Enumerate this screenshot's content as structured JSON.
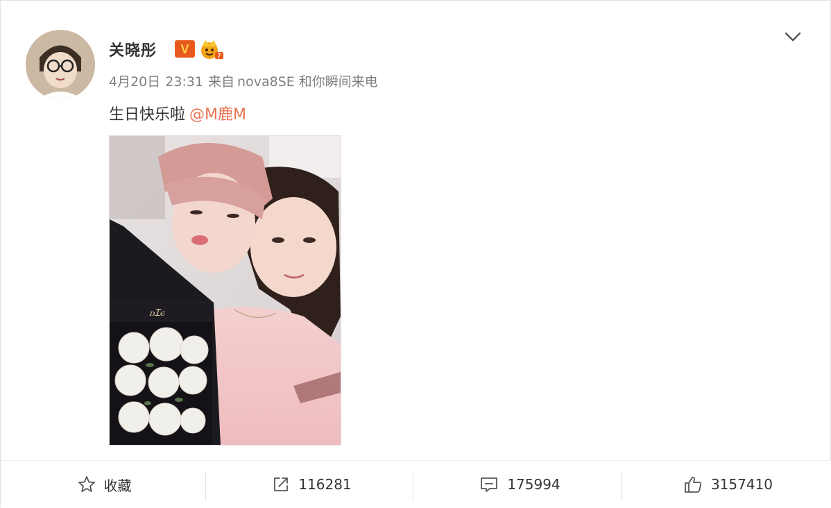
{
  "post": {
    "author": {
      "name": "关晓彤",
      "verified_badge": "V"
    },
    "meta": {
      "date": "4月20日",
      "time": "23:31",
      "source_prefix": "来自",
      "source": "nova8SE 和你瞬间来电"
    },
    "text": "生日快乐啦",
    "mention": "@M鹿M"
  },
  "actions": {
    "favorite_label": "收藏",
    "repost_count": "116281",
    "comment_count": "175994",
    "like_count": "3157410"
  },
  "colors": {
    "accent": "#eb7350",
    "meta_text": "#808080",
    "text": "#333333",
    "badge": "#e85a1c"
  },
  "icons": {
    "more": "chevron-down-icon",
    "favorite": "star-icon",
    "repost": "share-icon",
    "comment": "comment-icon",
    "like": "thumbs-up-icon"
  }
}
